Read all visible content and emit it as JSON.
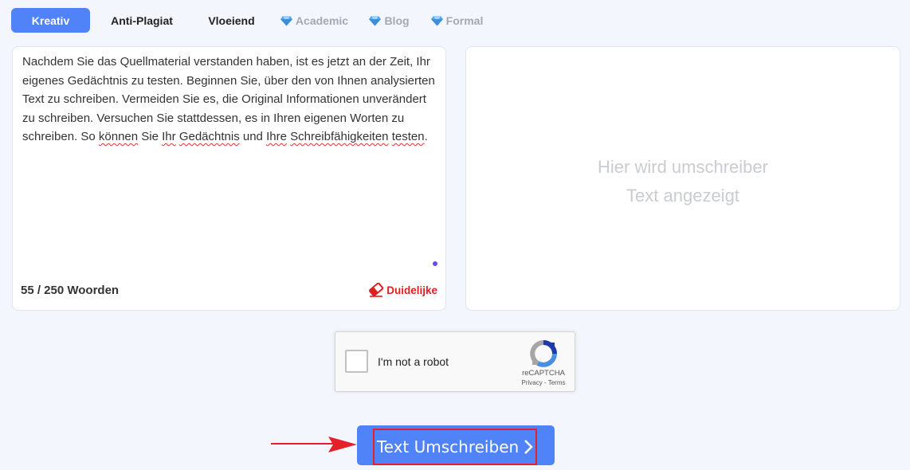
{
  "tabs": [
    {
      "label": "Kreativ",
      "active": true,
      "premium": false
    },
    {
      "label": "Anti-Plagiat",
      "active": false,
      "premium": false
    },
    {
      "label": "Vloeiend",
      "active": false,
      "premium": false
    },
    {
      "label": "Academic",
      "active": false,
      "premium": true,
      "icon": "diamond-icon"
    },
    {
      "label": "Blog",
      "active": false,
      "premium": true,
      "icon": "diamond-icon"
    },
    {
      "label": "Formal",
      "active": false,
      "premium": true,
      "icon": "diamond-icon"
    }
  ],
  "input": {
    "lines": [
      "Nachdem Sie das Quellmaterial verstanden haben, ist es jetzt an der Zeit, Ihr",
      "eigenes Gedächtnis zu testen. Beginnen Sie, über den von Ihnen analysierten",
      "Text zu schreiben. Vermeiden Sie es, die Original Informationen unverändert",
      "zu schreiben. Versuchen Sie stattdessen, es in Ihren eigenen Worten zu"
    ],
    "last_line": {
      "part1": "schreiben. So ",
      "w1": "können",
      "part2": " Sie ",
      "w2": "Ihr",
      "part3": " ",
      "w3": "Gedächtnis",
      "part4": " und ",
      "w4": "Ihre",
      "part5": " ",
      "w5": "Schreibfähigkeiten",
      "part6": " ",
      "w6": "testen",
      "part7": "."
    },
    "word_count": "55 / 250 Woorden",
    "clear_label": "Duidelijke"
  },
  "output": {
    "placeholder_line1": "Hier wird umschreiber",
    "placeholder_line2": "Text angezeigt"
  },
  "captcha": {
    "label": "I'm not a robot",
    "brand": "reCAPTCHA",
    "links": "Privacy - Terms"
  },
  "submit": {
    "label": "Text Umschreiben"
  },
  "colors": {
    "accent": "#4f83f7",
    "clear": "#e02020",
    "highlight_border": "#e4202a",
    "arrow": "#e4202a"
  }
}
